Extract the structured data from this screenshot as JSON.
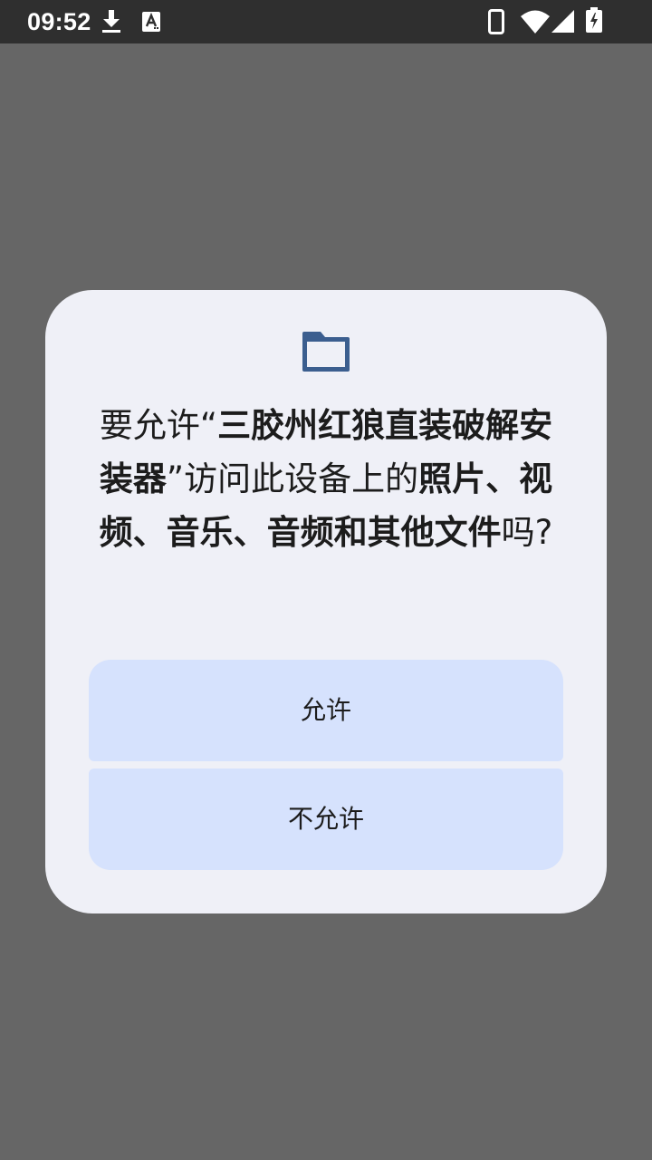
{
  "status_bar": {
    "time": "09:52",
    "icons": [
      "download-icon",
      "keyboard-a-icon",
      "phone-icon",
      "wifi-icon",
      "signal-icon",
      "battery-charging-icon"
    ]
  },
  "dialog": {
    "icon": "folder-icon",
    "message": {
      "prefix": "要允许“",
      "app_name": "三胶州红狼直装破解安装器",
      "middle": "”访问此设备上的",
      "resource": "照片、视频、音乐、音频和其他文件",
      "suffix": "吗?"
    },
    "allow_label": "允许",
    "deny_label": "不允许"
  },
  "colors": {
    "scrim": "#666666",
    "status_bar": "#2f2f2f",
    "dialog_bg": "#eff0f7",
    "button_bg": "#d6e2fd",
    "icon_accent": "#3b5e8f",
    "text": "#1c1c1c"
  }
}
